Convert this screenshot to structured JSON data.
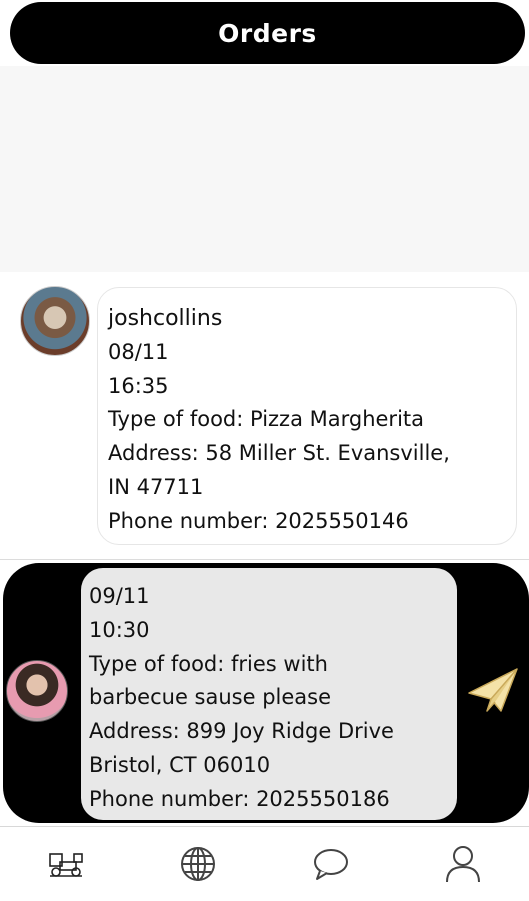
{
  "header": {
    "title": "Orders"
  },
  "orders": [
    {
      "username": "joshcollins",
      "date": "08/11",
      "time": "16:35",
      "food": "Type of food: Pizza Margherita",
      "address_line1": "Address: 58 Miller St. Evansville,",
      "address_line2": "IN 47711",
      "phone": "Phone number: 2025550146"
    },
    {
      "date": "09/11",
      "time": "10:30",
      "food_line1": "Type of food: fries with",
      "food_line2": "barbecue sause please",
      "address_line1": "Address: 899 Joy Ridge Drive",
      "address_line2": "Bristol, CT 06010",
      "phone": "Phone number: 2025550186"
    }
  ],
  "icons": {
    "send": "paper-plane-icon",
    "nav": [
      "delivery-icon",
      "globe-icon",
      "chat-bubble-icon",
      "user-icon"
    ]
  },
  "colors": {
    "header_bg": "#000000",
    "send_icon": "#f4e2a8",
    "card_highlight_bg": "#e8e8e8"
  }
}
